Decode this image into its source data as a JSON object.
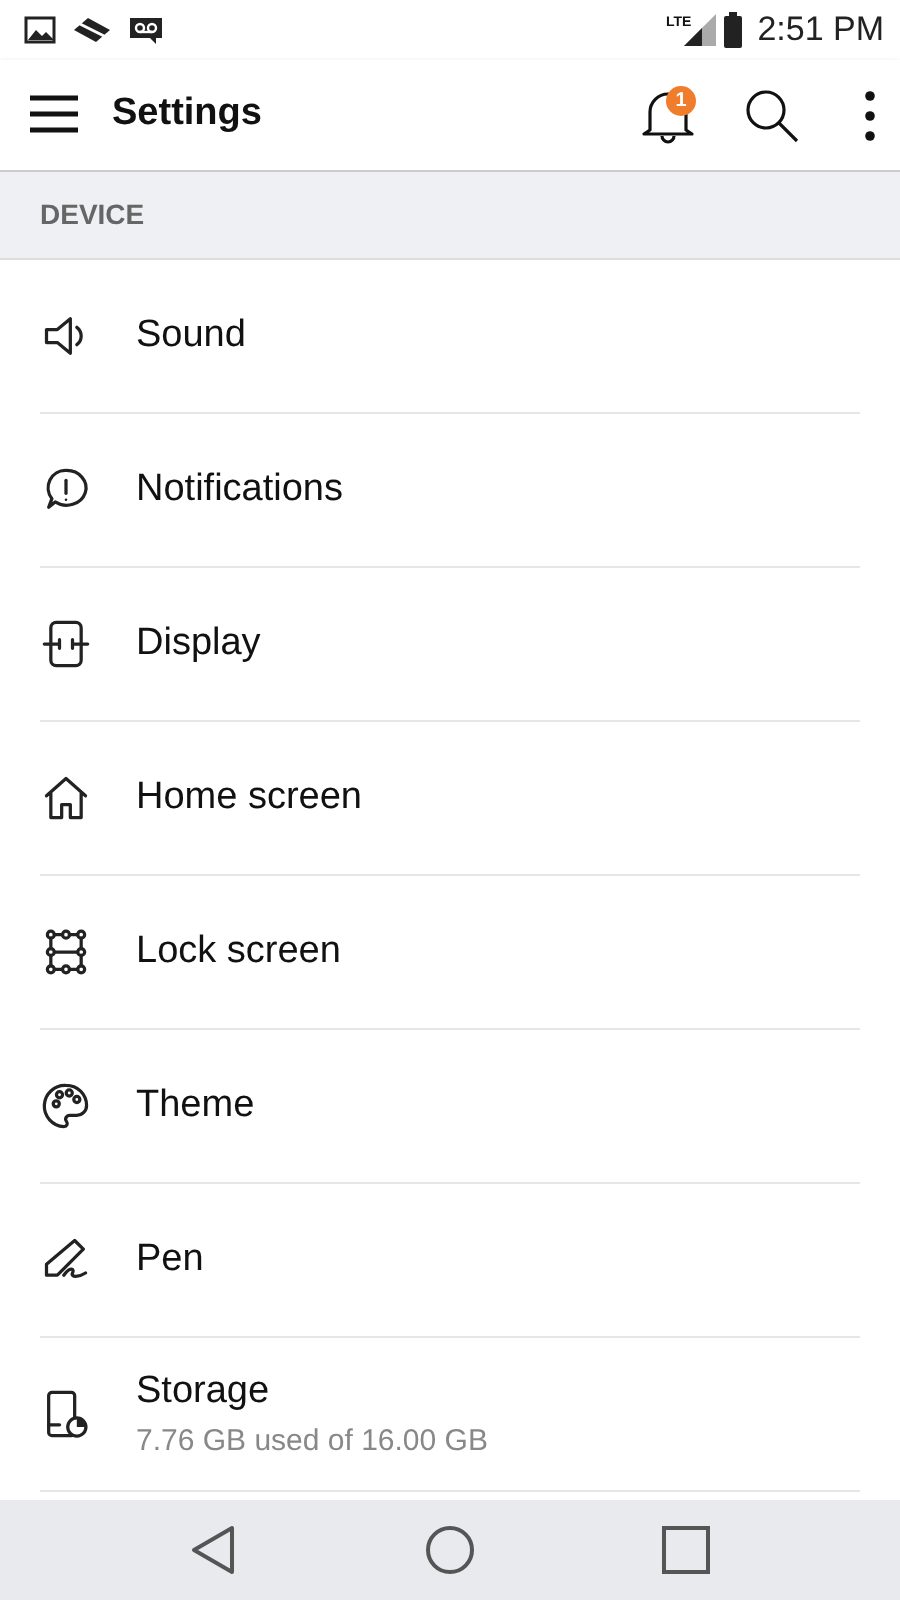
{
  "status_bar": {
    "time": "2:51 PM",
    "network": "LTE"
  },
  "app_bar": {
    "title": "Settings",
    "notification_count": "1"
  },
  "section": {
    "title": "DEVICE"
  },
  "items": [
    {
      "kind": "sound",
      "label": "Sound"
    },
    {
      "kind": "notifications",
      "label": "Notifications"
    },
    {
      "kind": "display",
      "label": "Display"
    },
    {
      "kind": "home",
      "label": "Home screen"
    },
    {
      "kind": "lock",
      "label": "Lock screen"
    },
    {
      "kind": "theme",
      "label": "Theme"
    },
    {
      "kind": "pen",
      "label": "Pen"
    },
    {
      "kind": "storage",
      "label": "Storage",
      "subtitle": "7.76 GB used of 16.00 GB"
    }
  ]
}
